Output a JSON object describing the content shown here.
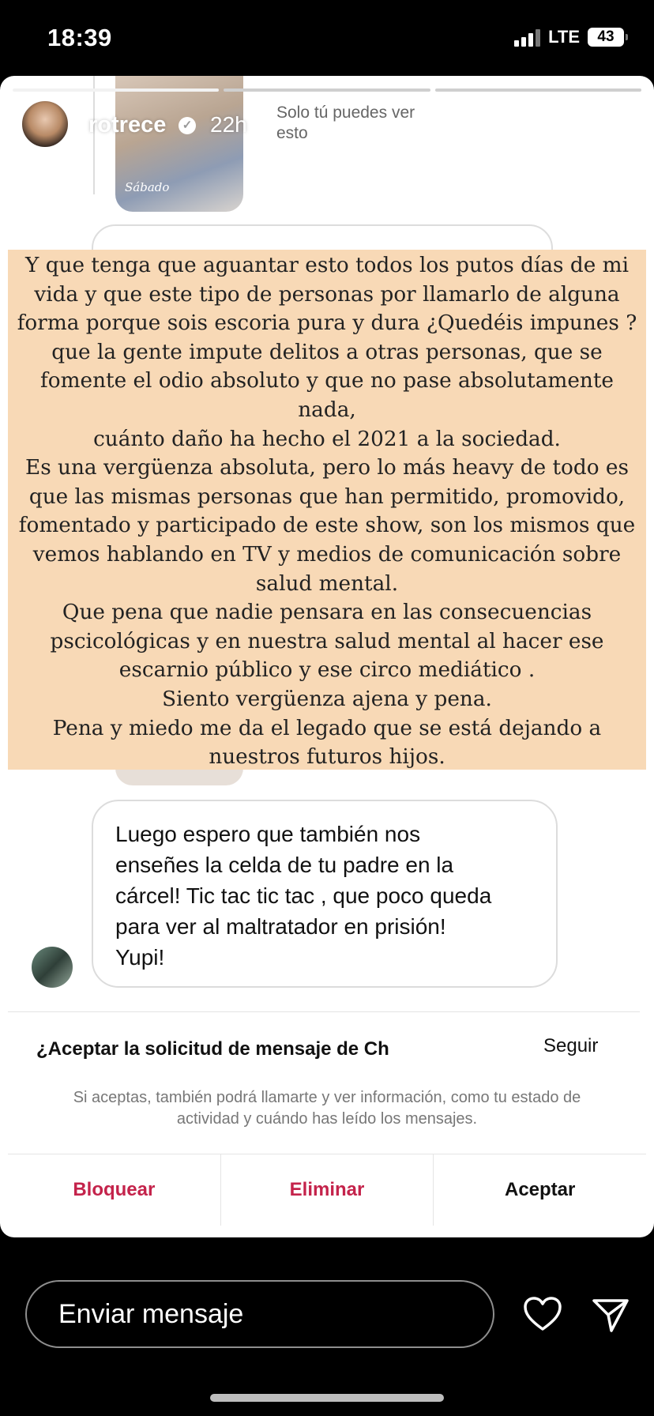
{
  "status_bar": {
    "time": "18:39",
    "network": "LTE",
    "battery": "43"
  },
  "story": {
    "username": "rotrece",
    "time_ago": "22h",
    "visibility": "Solo tú puedes ver esto",
    "more_icon": "•••",
    "photo_caption": "Sábado"
  },
  "overlay_text": [
    "Y que tenga que aguantar esto todos los putos días de mi",
    "vida y que este tipo de personas por llamarlo de alguna",
    "forma porque sois escoria pura y dura ¿Quedéis impunes ?",
    "que la gente impute delitos a otras personas, que se",
    "fomente el odio absoluto y que no pase absolutamente",
    "nada,",
    "cuánto daño ha hecho el 2021 a la sociedad.",
    "Es una vergüenza absoluta, pero lo más heavy de todo es",
    "que las mismas personas que han permitido, promovido,",
    "fomentado y participado de este show, son los mismos que",
    "vemos hablando en TV y medios de comunicación sobre",
    "salud mental.",
    "Que pena que nadie pensara en las consecuencias",
    "pscicológicas y en nuestra salud mental al hacer ese",
    "escarnio público y ese circo mediático .",
    "Siento vergüenza ajena y pena.",
    "Pena y miedo me da el legado que se está dejando a",
    "nuestros futuros hijos."
  ],
  "message": {
    "lines": [
      "Luego espero que también nos",
      "enseñes la celda de tu padre en la",
      "cárcel! Tic tac tic tac , que poco queda",
      "para ver al maltratador en prisión!",
      "Yupi!"
    ]
  },
  "request": {
    "title": "¿Aceptar la solicitud de mensaje de Ch",
    "right_partial": "Seguir",
    "description": "Si aceptas, también podrá llamarte y ver información, como tu estado de actividad y cuándo has leído los mensajes."
  },
  "actions": {
    "block": "Bloquear",
    "delete": "Eliminar",
    "accept": "Aceptar"
  },
  "bottom_bar": {
    "placeholder": "Enviar mensaje"
  },
  "colors": {
    "overlay_bg": "#f8d9b6",
    "danger": "#c4234b"
  }
}
